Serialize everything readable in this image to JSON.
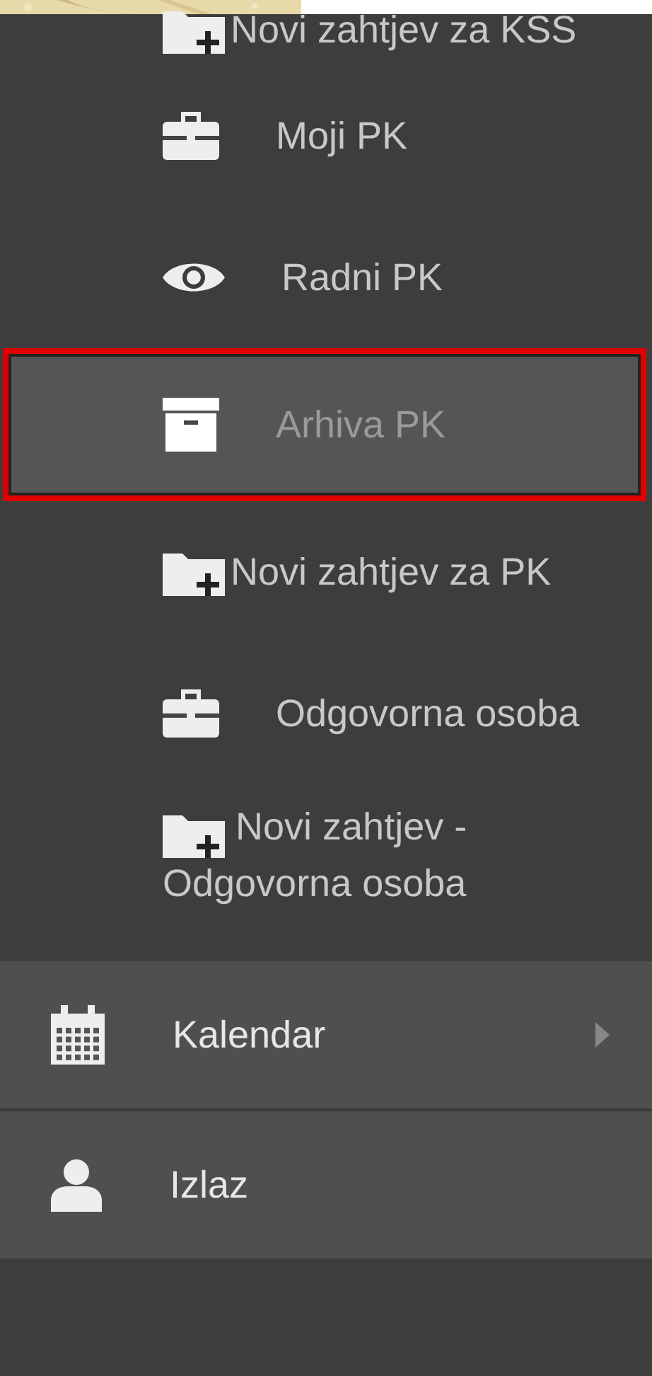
{
  "submenu": [
    {
      "kind": "folder_plus",
      "label": "Novi zahtjev za KSS",
      "selected": false
    },
    {
      "kind": "briefcase",
      "label": "Moji PK",
      "selected": false
    },
    {
      "kind": "eye",
      "label": "Radni PK",
      "selected": false
    },
    {
      "kind": "archive",
      "label": "Arhiva PK",
      "selected": true
    },
    {
      "kind": "folder_plus",
      "label": "Novi zahtjev za PK",
      "selected": false
    },
    {
      "kind": "briefcase",
      "label": "Odgovorna osoba",
      "selected": false
    },
    {
      "kind": "folder_plus",
      "label": "Novi zahtjev - Odgovorna osoba",
      "selected": false
    }
  ],
  "menu": [
    {
      "kind": "calendar",
      "label": "Kalendar",
      "has_submenu": true
    },
    {
      "kind": "user",
      "label": "Izlaz",
      "has_submenu": false
    }
  ]
}
